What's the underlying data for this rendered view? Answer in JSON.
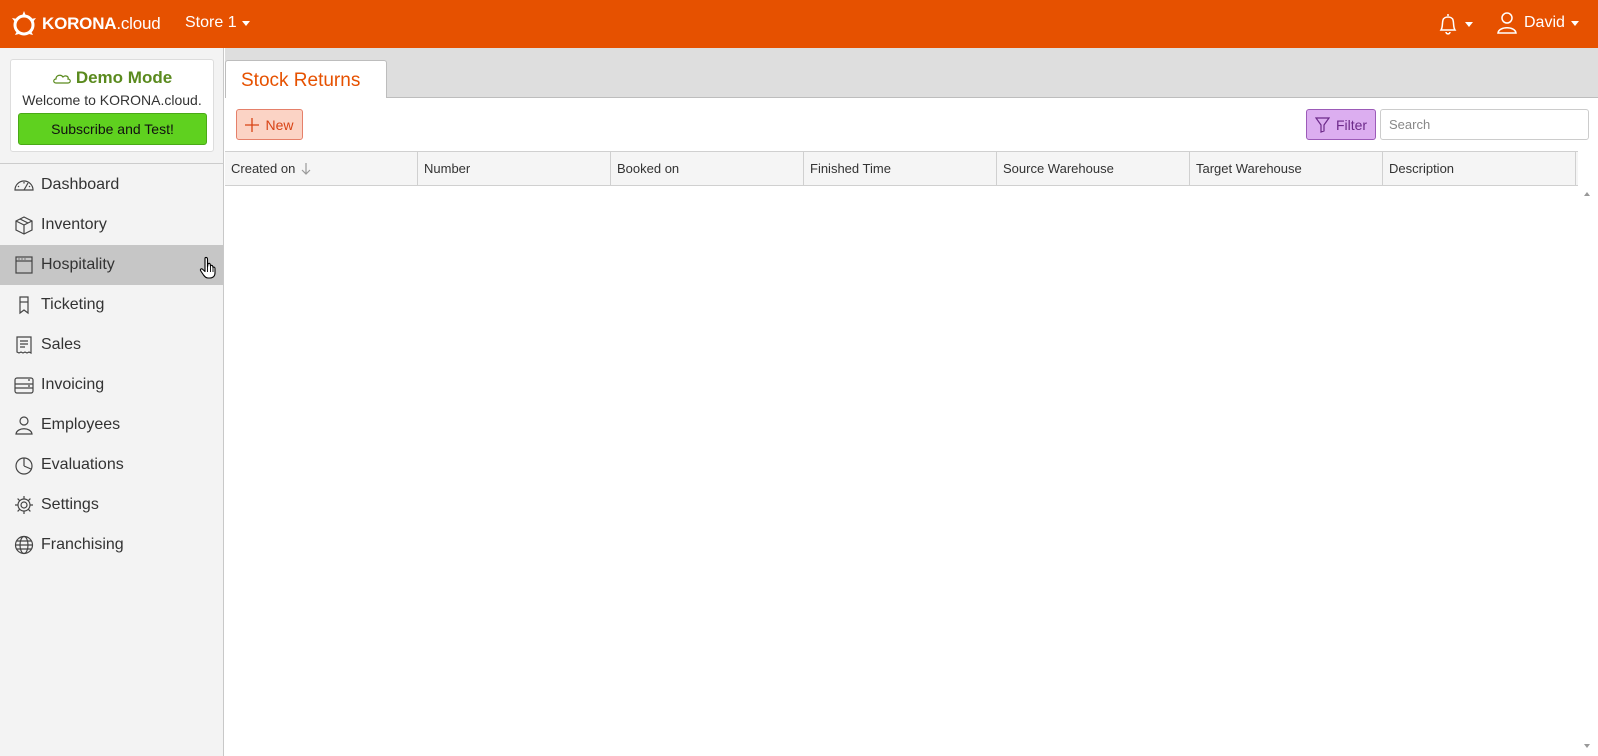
{
  "header": {
    "logo_bold": "KORONA",
    "logo_light": ".cloud",
    "store": "Store 1",
    "user": "David",
    "icons": {
      "bell": "bell-icon",
      "user": "user-icon"
    }
  },
  "demo": {
    "title": "Demo Mode",
    "welcome": "Welcome to KORONA.cloud.",
    "subscribe_label": "Subscribe and Test!"
  },
  "sidebar": {
    "items": [
      {
        "label": "Dashboard",
        "icon": "dashboard-icon"
      },
      {
        "label": "Inventory",
        "icon": "box-icon"
      },
      {
        "label": "Hospitality",
        "icon": "hospitality-icon",
        "active": true
      },
      {
        "label": "Ticketing",
        "icon": "ticket-icon"
      },
      {
        "label": "Sales",
        "icon": "receipt-icon"
      },
      {
        "label": "Invoicing",
        "icon": "invoice-icon"
      },
      {
        "label": "Employees",
        "icon": "person-icon"
      },
      {
        "label": "Evaluations",
        "icon": "pie-chart-icon"
      },
      {
        "label": "Settings",
        "icon": "gear-icon"
      },
      {
        "label": "Franchising",
        "icon": "globe-icon"
      }
    ]
  },
  "main": {
    "tab": "Stock Returns",
    "new_label": "New",
    "filter_label": "Filter",
    "search_placeholder": "Search",
    "columns": [
      "Created on",
      "Number",
      "Booked on",
      "Finished Time",
      "Source Warehouse",
      "Target Warehouse",
      "Description"
    ]
  },
  "colors": {
    "brand": "#e65100",
    "subscribe": "#5fd11f",
    "filter": "#dcaef0",
    "demo_title": "#5a8a1e"
  }
}
